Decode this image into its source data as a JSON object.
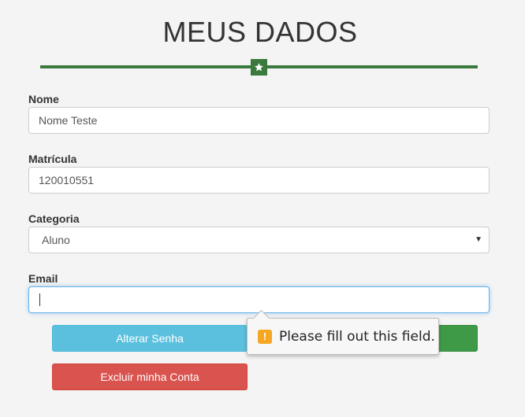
{
  "page": {
    "title": "MEUS DADOS",
    "accent_color": "#3a7a3d"
  },
  "divider": {
    "icon": "star-icon"
  },
  "form": {
    "nome": {
      "label": "Nome",
      "value": "Nome Teste"
    },
    "matricula": {
      "label": "Matrícula",
      "value": "120010551"
    },
    "categoria": {
      "label": "Categoria",
      "value": "Aluno"
    },
    "email": {
      "label": "Email",
      "value": ""
    }
  },
  "buttons": {
    "alterar_senha": "Alterar Senha",
    "save": "",
    "excluir_conta": "Excluir minha Conta"
  },
  "validation_tooltip": {
    "icon": "warning-icon",
    "icon_glyph": "!",
    "message": "Please fill out this field."
  },
  "colors": {
    "info": "#5bc0de",
    "success": "#3e9a46",
    "danger": "#d9534f",
    "warning": "#f5a623"
  }
}
